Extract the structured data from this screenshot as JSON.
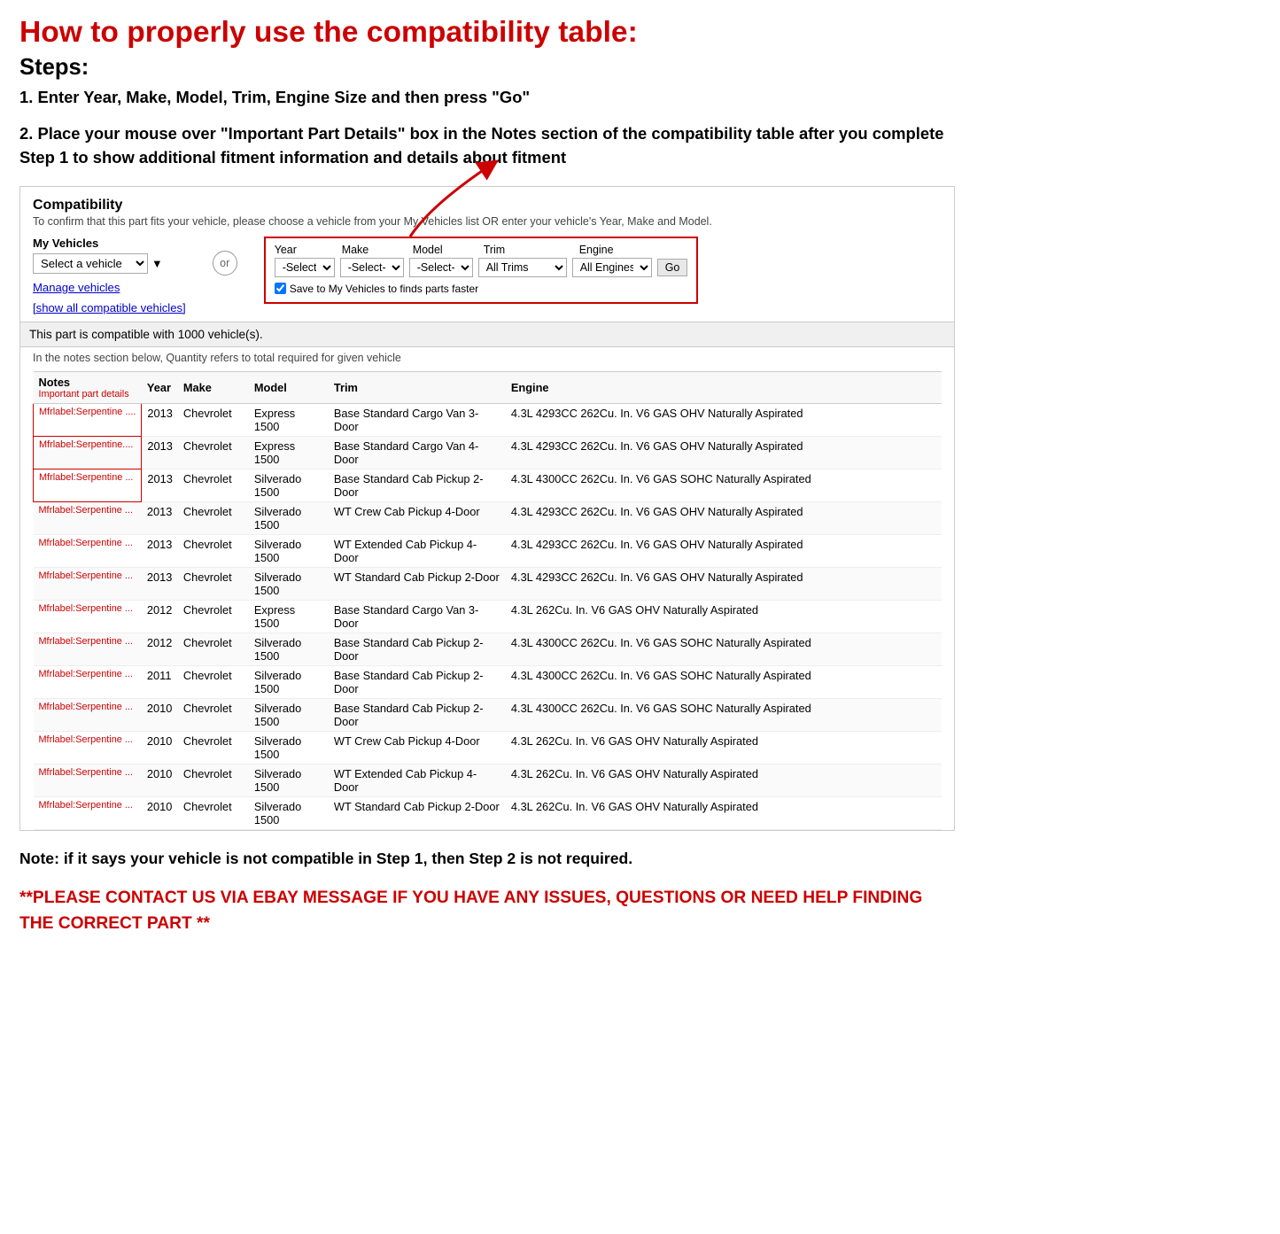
{
  "title": "How to properly use the compatibility table:",
  "steps_label": "Steps:",
  "step1": "1. Enter Year, Make, Model, Trim, Engine Size and then press \"Go\"",
  "step2": "2. Place your mouse over \"Important Part Details\" box in the Notes section of the compatibility table after you complete Step 1 to show additional fitment information and details about fitment",
  "compat_section": {
    "title": "Compatibility",
    "subtitle": "To confirm that this part fits your vehicle, please choose a vehicle from your My Vehicles list OR enter your vehicle's Year, Make and Model.",
    "my_vehicles_label": "My Vehicles",
    "select_vehicle_placeholder": "Select a vehicle",
    "or_label": "or",
    "manage_vehicles": "Manage vehicles",
    "show_all": "[show all compatible vehicles]",
    "year_label": "Year",
    "make_label": "Make",
    "model_label": "Model",
    "trim_label": "Trim",
    "engine_label": "Engine",
    "year_default": "-Select-",
    "make_default": "-Select-",
    "model_default": "-Select-",
    "trim_default": "All Trims",
    "engine_default": "All Engines",
    "go_button": "Go",
    "save_checkbox_label": "Save to My Vehicles to finds parts faster",
    "compat_count": "This part is compatible with 1000 vehicle(s).",
    "compat_note": "In the notes section below, Quantity refers to total required for given vehicle",
    "table_headers": [
      "Notes",
      "Year",
      "Make",
      "Model",
      "Trim",
      "Engine"
    ],
    "notes_sub": "Important part details",
    "rows": [
      [
        "Mfrlabel:Serpentine ....",
        "2013",
        "Chevrolet",
        "Express 1500",
        "Base Standard Cargo Van 3-Door",
        "4.3L 4293CC 262Cu. In. V6 GAS OHV Naturally Aspirated"
      ],
      [
        "Mfrlabel:Serpentine....",
        "2013",
        "Chevrolet",
        "Express 1500",
        "Base Standard Cargo Van 4-Door",
        "4.3L 4293CC 262Cu. In. V6 GAS OHV Naturally Aspirated"
      ],
      [
        "Mfrlabel:Serpentine ...",
        "2013",
        "Chevrolet",
        "Silverado 1500",
        "Base Standard Cab Pickup 2-Door",
        "4.3L 4300CC 262Cu. In. V6 GAS SOHC Naturally Aspirated"
      ],
      [
        "Mfrlabel:Serpentine ...",
        "2013",
        "Chevrolet",
        "Silverado 1500",
        "WT Crew Cab Pickup 4-Door",
        "4.3L 4293CC 262Cu. In. V6 GAS OHV Naturally Aspirated"
      ],
      [
        "Mfrlabel:Serpentine ...",
        "2013",
        "Chevrolet",
        "Silverado 1500",
        "WT Extended Cab Pickup 4-Door",
        "4.3L 4293CC 262Cu. In. V6 GAS OHV Naturally Aspirated"
      ],
      [
        "Mfrlabel:Serpentine ...",
        "2013",
        "Chevrolet",
        "Silverado 1500",
        "WT Standard Cab Pickup 2-Door",
        "4.3L 4293CC 262Cu. In. V6 GAS OHV Naturally Aspirated"
      ],
      [
        "Mfrlabel:Serpentine ...",
        "2012",
        "Chevrolet",
        "Express 1500",
        "Base Standard Cargo Van 3-Door",
        "4.3L 262Cu. In. V6 GAS OHV Naturally Aspirated"
      ],
      [
        "Mfrlabel:Serpentine ...",
        "2012",
        "Chevrolet",
        "Silverado 1500",
        "Base Standard Cab Pickup 2-Door",
        "4.3L 4300CC 262Cu. In. V6 GAS SOHC Naturally Aspirated"
      ],
      [
        "Mfrlabel:Serpentine ...",
        "2011",
        "Chevrolet",
        "Silverado 1500",
        "Base Standard Cab Pickup 2-Door",
        "4.3L 4300CC 262Cu. In. V6 GAS SOHC Naturally Aspirated"
      ],
      [
        "Mfrlabel:Serpentine ...",
        "2010",
        "Chevrolet",
        "Silverado 1500",
        "Base Standard Cab Pickup 2-Door",
        "4.3L 4300CC 262Cu. In. V6 GAS SOHC Naturally Aspirated"
      ],
      [
        "Mfrlabel:Serpentine ...",
        "2010",
        "Chevrolet",
        "Silverado 1500",
        "WT Crew Cab Pickup 4-Door",
        "4.3L 262Cu. In. V6 GAS OHV Naturally Aspirated"
      ],
      [
        "Mfrlabel:Serpentine ...",
        "2010",
        "Chevrolet",
        "Silverado 1500",
        "WT Extended Cab Pickup 4-Door",
        "4.3L 262Cu. In. V6 GAS OHV Naturally Aspirated"
      ],
      [
        "Mfrlabel:Serpentine ...",
        "2010",
        "Chevrolet",
        "Silverado 1500",
        "WT Standard Cab Pickup 2-Door",
        "4.3L 262Cu. In. V6 GAS OHV Naturally Aspirated"
      ]
    ]
  },
  "note_text": "Note: if it says your vehicle is not compatible in Step 1, then Step 2 is not required.",
  "contact_text": "**PLEASE CONTACT US VIA EBAY MESSAGE IF YOU HAVE ANY ISSUES, QUESTIONS OR NEED HELP FINDING THE CORRECT PART **"
}
